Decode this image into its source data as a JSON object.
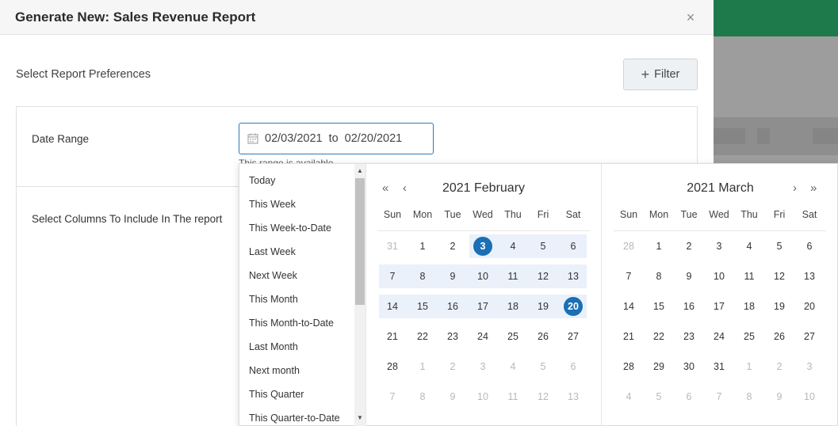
{
  "modal": {
    "title": "Generate New: Sales Revenue Report",
    "close_label": "×",
    "prefs_label": "Select Report Preferences",
    "filter_label": "Filter",
    "date_range_label": "Date Range",
    "columns_label": "Select Columns To Include In The report",
    "hint_text": "This range is available"
  },
  "date_input": {
    "start": "02/03/2021",
    "separator": "to",
    "end": "02/20/2021"
  },
  "presets": [
    "Today",
    "This Week",
    "This Week-to-Date",
    "Last Week",
    "Next Week",
    "This Month",
    "This Month-to-Date",
    "Last Month",
    "Next month",
    "This Quarter",
    "This Quarter-to-Date"
  ],
  "calendars": [
    {
      "title": "2021 February",
      "dow": [
        "Sun",
        "Mon",
        "Tue",
        "Wed",
        "Thu",
        "Fri",
        "Sat"
      ],
      "weeks": [
        [
          "31",
          "1",
          "2",
          "3",
          "4",
          "5",
          "6"
        ],
        [
          "7",
          "8",
          "9",
          "10",
          "11",
          "12",
          "13"
        ],
        [
          "14",
          "15",
          "16",
          "17",
          "18",
          "19",
          "20"
        ],
        [
          "21",
          "22",
          "23",
          "24",
          "25",
          "26",
          "27"
        ],
        [
          "28",
          "1",
          "2",
          "3",
          "4",
          "5",
          "6"
        ],
        [
          "7",
          "8",
          "9",
          "10",
          "11",
          "12",
          "13"
        ]
      ],
      "muted": [
        [
          0,
          0
        ],
        [
          4,
          1
        ],
        [
          4,
          2
        ],
        [
          4,
          3
        ],
        [
          4,
          4
        ],
        [
          4,
          5
        ],
        [
          4,
          6
        ],
        [
          5,
          0
        ],
        [
          5,
          1
        ],
        [
          5,
          2
        ],
        [
          5,
          3
        ],
        [
          5,
          4
        ],
        [
          5,
          5
        ],
        [
          5,
          6
        ]
      ],
      "selected": [
        [
          0,
          3
        ],
        [
          2,
          6
        ]
      ],
      "range": [
        [
          0,
          3,
          6
        ],
        [
          1,
          0,
          6
        ],
        [
          2,
          0,
          6
        ]
      ]
    },
    {
      "title": "2021 March",
      "dow": [
        "Sun",
        "Mon",
        "Tue",
        "Wed",
        "Thu",
        "Fri",
        "Sat"
      ],
      "weeks": [
        [
          "28",
          "1",
          "2",
          "3",
          "4",
          "5",
          "6"
        ],
        [
          "7",
          "8",
          "9",
          "10",
          "11",
          "12",
          "13"
        ],
        [
          "14",
          "15",
          "16",
          "17",
          "18",
          "19",
          "20"
        ],
        [
          "21",
          "22",
          "23",
          "24",
          "25",
          "26",
          "27"
        ],
        [
          "28",
          "29",
          "30",
          "31",
          "1",
          "2",
          "3"
        ],
        [
          "4",
          "5",
          "6",
          "7",
          "8",
          "9",
          "10"
        ]
      ],
      "muted": [
        [
          0,
          0
        ],
        [
          4,
          4
        ],
        [
          4,
          5
        ],
        [
          4,
          6
        ],
        [
          5,
          0
        ],
        [
          5,
          1
        ],
        [
          5,
          2
        ],
        [
          5,
          3
        ],
        [
          5,
          4
        ],
        [
          5,
          5
        ],
        [
          5,
          6
        ]
      ],
      "selected": [],
      "range": []
    }
  ],
  "colors": {
    "accent": "#1a6fb5",
    "range_band": "#eaf1fa",
    "topbar": "#1e7a4a"
  }
}
